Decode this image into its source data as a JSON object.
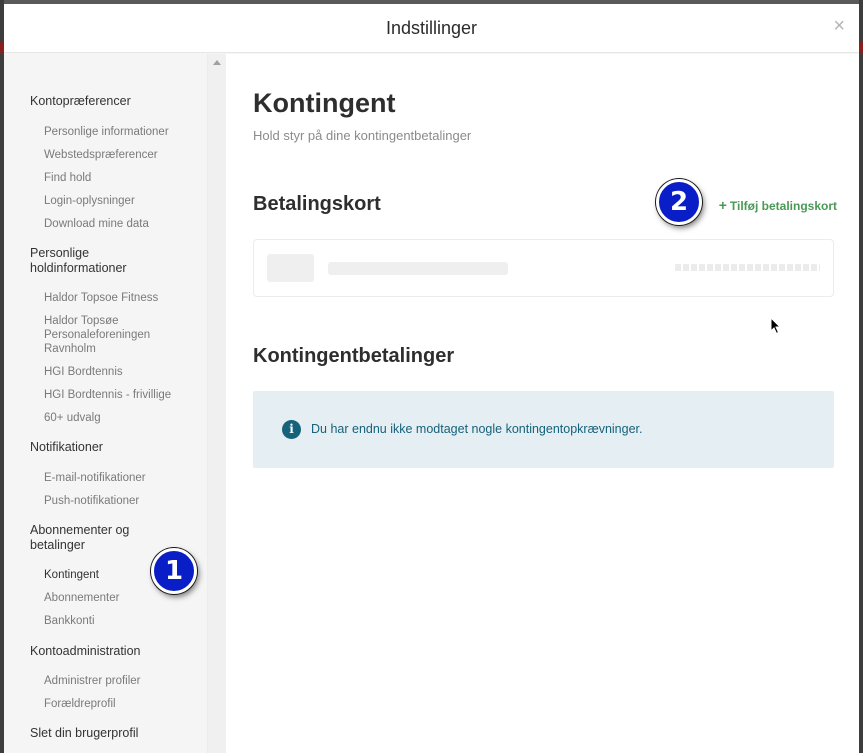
{
  "modal": {
    "title": "Indstillinger",
    "close_glyph": "×"
  },
  "sidebar": {
    "sections": [
      {
        "label": "Kontopræferencer",
        "items": [
          "Personlige informationer",
          "Webstedspræferencer",
          "Find hold",
          "Login-oplysninger",
          "Download mine data"
        ]
      },
      {
        "label": "Personlige holdinformationer",
        "items": [
          "Haldor Topsoe Fitness",
          "Haldor Topsøe Personaleforeningen Ravnholm",
          "HGI Bordtennis",
          "HGI Bordtennis - frivillige",
          "60+ udvalg"
        ]
      },
      {
        "label": "Notifikationer",
        "items": [
          "E-mail-notifikationer",
          "Push-notifikationer"
        ]
      },
      {
        "label": "Abonnementer og betalinger",
        "items": [
          "Kontingent",
          "Abonnementer",
          "Bankkonti"
        ]
      },
      {
        "label": "Kontoadministration",
        "items": [
          "Administrer profiler",
          "Forældreprofil"
        ]
      },
      {
        "label": "Slet din brugerprofil",
        "items": []
      }
    ],
    "active_item": "Kontingent"
  },
  "main": {
    "title": "Kontingent",
    "subtitle": "Hold styr på dine kontingentbetalinger",
    "cards_heading": "Betalingskort",
    "add_card_label": "Tilføj betalingskort",
    "add_card_icon": "plus-icon",
    "payments_heading": "Kontingentbetalinger",
    "info_message": "Du har endnu ikke modtaget nogle kontingentopkrævninger.",
    "info_icon_glyph": "i"
  },
  "annotations": {
    "badge_1": "1",
    "badge_2": "2"
  },
  "colors": {
    "accent_green": "#4a9a55",
    "info_blue": "#16627a",
    "info_bg": "#e5eef2",
    "badge_blue": "#0a1ec8"
  }
}
